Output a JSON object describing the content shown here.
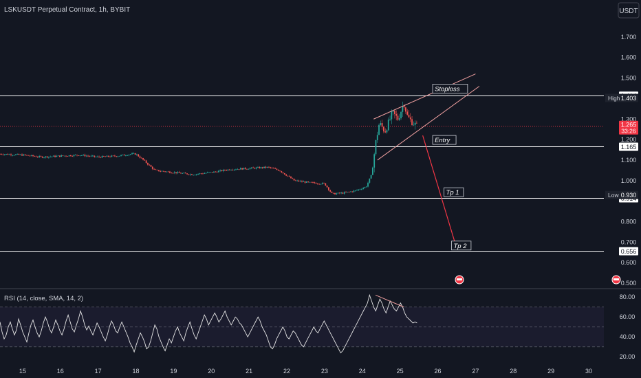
{
  "header": {
    "title": "LSKUSDT Perpetual Contract, 1h, BYBIT",
    "currency_button": "USDT"
  },
  "colors": {
    "background": "#131722",
    "up": "#26a69a",
    "down": "#ef5350",
    "price_tag": "#f23645",
    "rsi_line": "#e6e6e6",
    "channel": "#f0a0a0",
    "projection": "#f23645",
    "level": "#ffffff"
  },
  "chart_data": [
    {
      "type": "candlestick",
      "title": "LSKUSDT Perpetual Contract, 1h, BYBIT",
      "x_ticks": [
        "15",
        "16",
        "17",
        "18",
        "19",
        "20",
        "21",
        "22",
        "23",
        "24",
        "25",
        "26",
        "27",
        "28",
        "29",
        "30"
      ],
      "y_ticks": [
        "1.700",
        "1.600",
        "1.500",
        "1.300",
        "1.200",
        "1.100",
        "1.000",
        "0.800",
        "0.700",
        "0.600",
        "0.500"
      ],
      "ylim": [
        0.49,
        1.78
      ],
      "xlim": [
        14.4,
        30.4
      ],
      "price_path": [
        [
          14.4,
          1.13
        ],
        [
          15.0,
          1.125
        ],
        [
          15.5,
          1.115
        ],
        [
          16.0,
          1.12
        ],
        [
          16.5,
          1.125
        ],
        [
          17.0,
          1.115
        ],
        [
          17.5,
          1.12
        ],
        [
          17.9,
          1.13
        ],
        [
          18.0,
          1.13
        ],
        [
          18.2,
          1.1
        ],
        [
          18.5,
          1.05
        ],
        [
          19.0,
          1.04
        ],
        [
          19.5,
          1.03
        ],
        [
          20.0,
          1.04
        ],
        [
          20.5,
          1.055
        ],
        [
          21.0,
          1.06
        ],
        [
          21.5,
          1.065
        ],
        [
          21.8,
          1.05
        ],
        [
          22.2,
          1.0
        ],
        [
          22.6,
          0.99
        ],
        [
          23.0,
          0.985
        ],
        [
          23.2,
          0.935
        ],
        [
          23.5,
          0.94
        ],
        [
          23.8,
          0.95
        ],
        [
          24.1,
          0.97
        ],
        [
          24.25,
          1.03
        ],
        [
          24.35,
          1.18
        ],
        [
          24.45,
          1.28
        ],
        [
          24.6,
          1.24
        ],
        [
          24.8,
          1.33
        ],
        [
          24.95,
          1.3
        ],
        [
          25.1,
          1.38
        ],
        [
          25.2,
          1.31
        ],
        [
          25.3,
          1.29
        ],
        [
          25.45,
          1.265
        ]
      ],
      "levels": [
        {
          "value": 1.414,
          "label": "1.414"
        },
        {
          "value": 1.165,
          "label": "1.165"
        },
        {
          "value": 0.914,
          "label": "0.914"
        },
        {
          "value": 0.656,
          "label": "0.656"
        }
      ],
      "markers": [
        {
          "label": "High",
          "value": 1.403,
          "text": "1.403"
        },
        {
          "label": "Low",
          "value": 0.93,
          "text": "0.930"
        }
      ],
      "current_price": {
        "value": 1.265,
        "text": "1.265",
        "countdown": "33:26"
      },
      "annotations": [
        {
          "text": "Stoploss",
          "x": 25.9,
          "y": 1.44
        },
        {
          "text": "Entry",
          "x": 25.9,
          "y": 1.19
        },
        {
          "text": "Tp 1",
          "x": 26.2,
          "y": 0.935
        },
        {
          "text": "Tp 2",
          "x": 26.4,
          "y": 0.675
        }
      ],
      "channel": {
        "upper": [
          [
            24.3,
            1.3
          ],
          [
            27.0,
            1.52
          ]
        ],
        "lower": [
          [
            24.4,
            1.1
          ],
          [
            27.1,
            1.46
          ]
        ]
      },
      "projection": [
        [
          25.6,
          1.22
        ],
        [
          26.5,
          0.67
        ]
      ]
    },
    {
      "type": "line",
      "title": "RSI (14, close, SMA, 14, 2)",
      "y_ticks": [
        "80.00",
        "60.00",
        "40.00",
        "20.00"
      ],
      "ylim": [
        16,
        85
      ],
      "bands": [
        70,
        50,
        30
      ],
      "values": [
        55,
        45,
        38,
        42,
        50,
        55,
        48,
        42,
        47,
        58,
        52,
        45,
        40,
        35,
        44,
        52,
        57,
        50,
        44,
        40,
        46,
        54,
        60,
        55,
        48,
        44,
        50,
        57,
        52,
        46,
        42,
        48,
        56,
        62,
        55,
        48,
        45,
        52,
        58,
        66,
        60,
        52,
        47,
        51,
        46,
        42,
        48,
        54,
        50,
        45,
        40,
        36,
        42,
        50,
        56,
        52,
        46,
        44,
        50,
        55,
        50,
        45,
        40,
        34,
        30,
        25,
        32,
        38,
        44,
        40,
        35,
        28,
        30,
        36,
        44,
        52,
        48,
        40,
        35,
        30,
        26,
        32,
        38,
        34,
        40,
        46,
        50,
        44,
        40,
        36,
        44,
        50,
        55,
        48,
        42,
        38,
        44,
        50,
        56,
        62,
        58,
        52,
        56,
        60,
        64,
        60,
        55,
        58,
        62,
        66,
        60,
        56,
        52,
        56,
        60,
        58,
        54,
        52,
        48,
        44,
        40,
        44,
        48,
        52,
        56,
        60,
        56,
        50,
        46,
        42,
        36,
        30,
        28,
        32,
        38,
        42,
        46,
        50,
        46,
        40,
        38,
        42,
        46,
        44,
        40,
        36,
        32,
        30,
        34,
        38,
        42,
        46,
        50,
        46,
        44,
        48,
        52,
        56,
        52,
        48,
        44,
        40,
        36,
        32,
        28,
        24,
        26,
        30,
        34,
        38,
        42,
        46,
        50,
        54,
        58,
        62,
        66,
        70,
        74,
        82,
        76,
        70,
        66,
        72,
        78,
        74,
        68,
        64,
        70,
        76,
        72,
        68,
        66,
        70,
        74,
        70,
        64,
        60,
        58,
        56,
        54,
        55,
        54
      ],
      "divergence": [
        [
          24.35,
          82
        ],
        [
          25.1,
          70
        ]
      ]
    }
  ]
}
